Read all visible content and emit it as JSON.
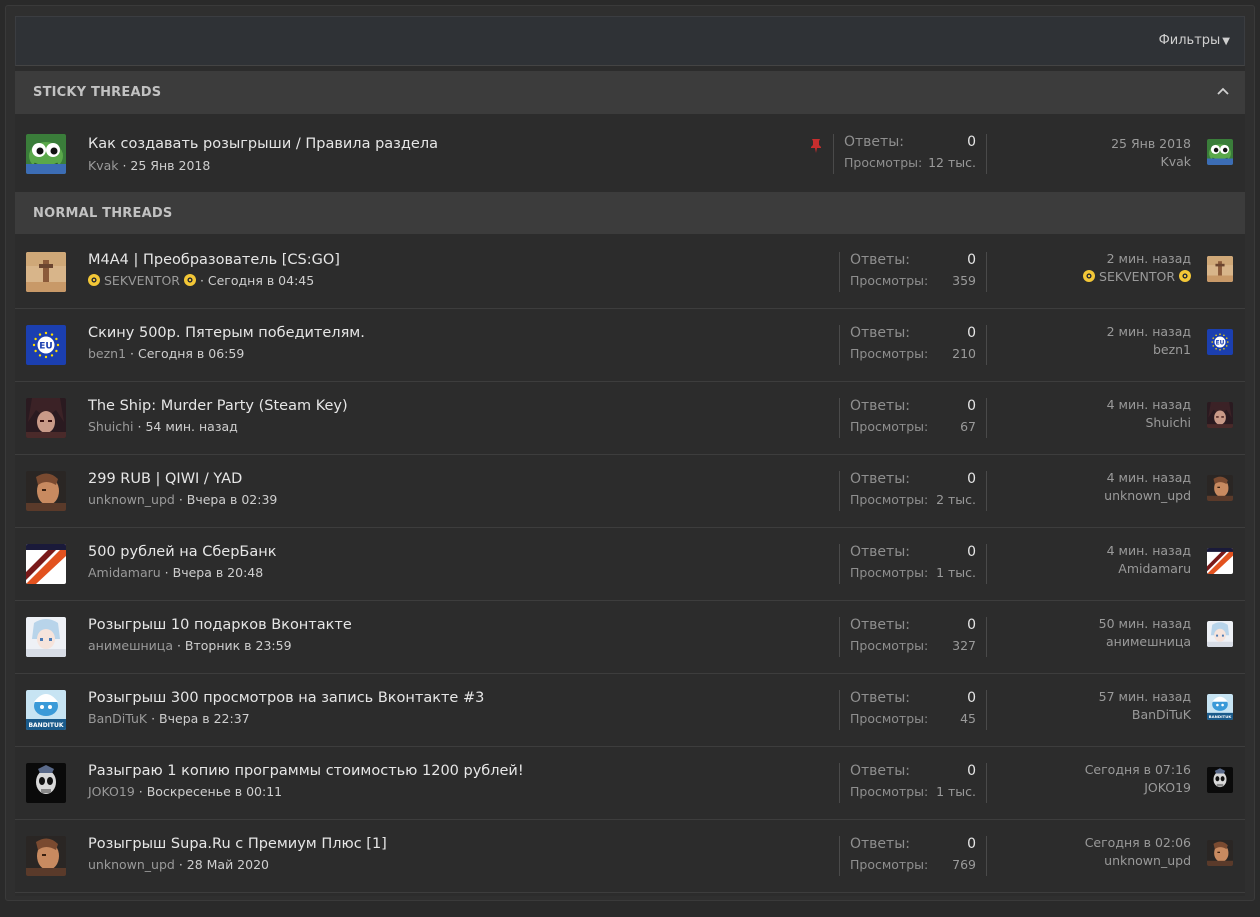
{
  "filters_label": "Фильтры",
  "sticky_header": "STICKY THREADS",
  "normal_header": "NORMAL THREADS",
  "replies_label": "Ответы:",
  "views_label": "Просмотры:",
  "sticky": [
    {
      "title": "Как создавать розыгрыши / Правила раздела",
      "author": "Kvak",
      "date": "25 Янв 2018",
      "replies": "0",
      "views": "12 тыс.",
      "last_date": "25 Янв 2018",
      "last_user": "Kvak",
      "avatar": "pepe-avatar",
      "pinned": true
    }
  ],
  "threads": [
    {
      "title": "M4A4 | Преобразователь [CS:GO]",
      "author": "SEKVENTOR",
      "date": "Сегодня в 04:45",
      "replies": "0",
      "views": "359",
      "last_date": "2 мин. назад",
      "last_user": "SEKVENTOR",
      "avatar": "desert-avatar",
      "decorated": true
    },
    {
      "title": "Скину 500р. Пятерым победителям.",
      "author": "bezn1",
      "date": "Сегодня в 06:59",
      "replies": "0",
      "views": "210",
      "last_date": "2 мин. назад",
      "last_user": "bezn1",
      "avatar": "eu-flag-avatar",
      "eu_text": "EU"
    },
    {
      "title": "The Ship: Murder Party (Steam Key)",
      "author": "Shuichi",
      "date": "54 мин. назад",
      "replies": "0",
      "views": "67",
      "last_date": "4 мин. назад",
      "last_user": "Shuichi",
      "avatar": "anime-dark-avatar"
    },
    {
      "title": "299 RUB | QIWI / YAD",
      "author": "unknown_upd",
      "date": "Вчера в 02:39",
      "replies": "0",
      "views": "2 тыс.",
      "last_date": "4 мин. назад",
      "last_user": "unknown_upd",
      "avatar": "face-avatar"
    },
    {
      "title": "500 рублей на СберБанк",
      "author": "Amidamaru",
      "date": "Вчера в 20:48",
      "replies": "0",
      "views": "1 тыс.",
      "last_date": "4 мин. назад",
      "last_user": "Amidamaru",
      "avatar": "orange-avatar"
    },
    {
      "title": "Розыгрыш 10 подарков Вконтакте",
      "author": "анимешница",
      "date": "Вторник в 23:59",
      "replies": "0",
      "views": "327",
      "last_date": "50 мин. назад",
      "last_user": "анимешница",
      "avatar": "anime-light-avatar"
    },
    {
      "title": "Розыгрыш 300 просмотров на запись Вконтакте #3",
      "author": "BanDiTuK",
      "date": "Вчера в 22:37",
      "replies": "0",
      "views": "45",
      "last_date": "57 мин. назад",
      "last_user": "BanDiTuK",
      "avatar": "smurf-avatar",
      "avatar_text": "BANDITUK"
    },
    {
      "title": "Разыграю 1 копию программы стоимостью 1200 рублей!",
      "author": "JOKO19",
      "date": "Воскресенье в 00:11",
      "replies": "0",
      "views": "1 тыс.",
      "last_date": "Сегодня в 07:16",
      "last_user": "JOKO19",
      "avatar": "skull-avatar"
    },
    {
      "title": "Розыгрыш Supa.Ru с Премиум Плюс [1]",
      "author": "unknown_upd",
      "date": "28 Май 2020",
      "replies": "0",
      "views": "769",
      "last_date": "Сегодня в 02:06",
      "last_user": "unknown_upd",
      "avatar": "face-avatar"
    }
  ]
}
